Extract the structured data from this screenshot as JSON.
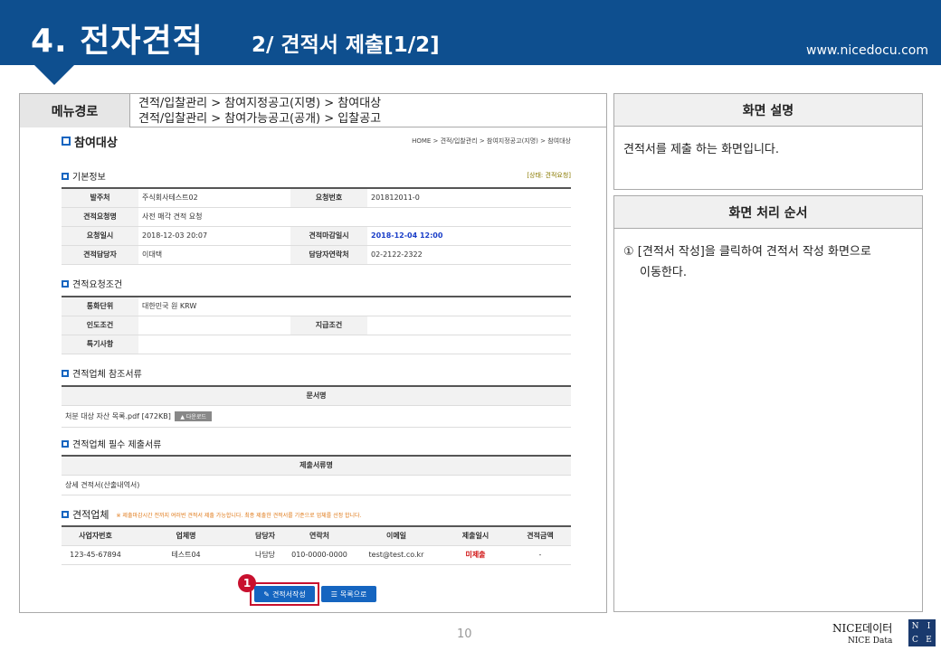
{
  "header": {
    "main_title": "4. 전자견적",
    "sub_title": "2/ 견적서 제출[1/2]",
    "site": "www.nicedocu.com"
  },
  "menu": {
    "label": "메뉴경로",
    "path_line1": "견적/입찰관리 > 참여지정공고(지명) > 참여대상",
    "path_line2": "견적/입찰관리 > 참여가능공고(공개) > 입찰공고"
  },
  "screen": {
    "page_title": "참여대상",
    "breadcrumb": "HOME > 견적/입찰관리 > 참여지정공고(지명) > 참여대상",
    "basic": {
      "title": "기본정보",
      "status": "[상태: 견적요청]",
      "rows": [
        [
          "발주처",
          "주식회사테스트02",
          "요청번호",
          "201812011-0"
        ],
        [
          "견적요청명",
          "사전 매각 견적 요청",
          "",
          ""
        ],
        [
          "요청일시",
          "2018-12-03 20:07",
          "견적마감일시",
          "2018-12-04 12:00"
        ],
        [
          "견적담당자",
          "이대택",
          "담당자연락처",
          "02-2122-2322"
        ]
      ]
    },
    "cond": {
      "title": "견적요청조건",
      "rows": [
        [
          "통화단위",
          "대한민국 원 KRW",
          "",
          ""
        ],
        [
          "인도조건",
          "",
          "지급조건",
          ""
        ],
        [
          "특기사항",
          "",
          "",
          ""
        ]
      ]
    },
    "ref": {
      "title": "견적업체 참조서류",
      "col": "문서명",
      "file": "처분 대상 자산 목록.pdf [472KB]",
      "download": "다운로드"
    },
    "req": {
      "title": "견적업체 필수 제출서류",
      "col": "제출서류명",
      "item": "상세 견적서(산출내역서)"
    },
    "vendor": {
      "title": "견적업체",
      "notice": "※ 제출마감시간 전까지 여러번 견적서 제출 가능합니다. 최종 제출한 견적서를 기준으로 업체를 선정 합니다.",
      "headers": [
        "사업자번호",
        "업체명",
        "담당자",
        "연락처",
        "이메일",
        "제출일시",
        "견적금액"
      ],
      "row": [
        "123-45-67894",
        "테스트04",
        "나담당",
        "010-0000-0000",
        "test@test.co.kr",
        "미제출",
        "-"
      ]
    },
    "buttons": {
      "write": "견적서작성",
      "list": "목록으로"
    },
    "marker": "1"
  },
  "panel": {
    "desc_title": "화면 설명",
    "desc_text": "견적서를 제출 하는 화면입니다.",
    "proc_title": "화면 처리 순서",
    "proc_line1": "① [견적서 작성]을 클릭하여 견적서 작성 화면으로",
    "proc_line2": "이동한다."
  },
  "footer": {
    "page": "10",
    "brand": "NICE데이터",
    "brand_sub": "NICE Data",
    "logo": "NICE"
  }
}
